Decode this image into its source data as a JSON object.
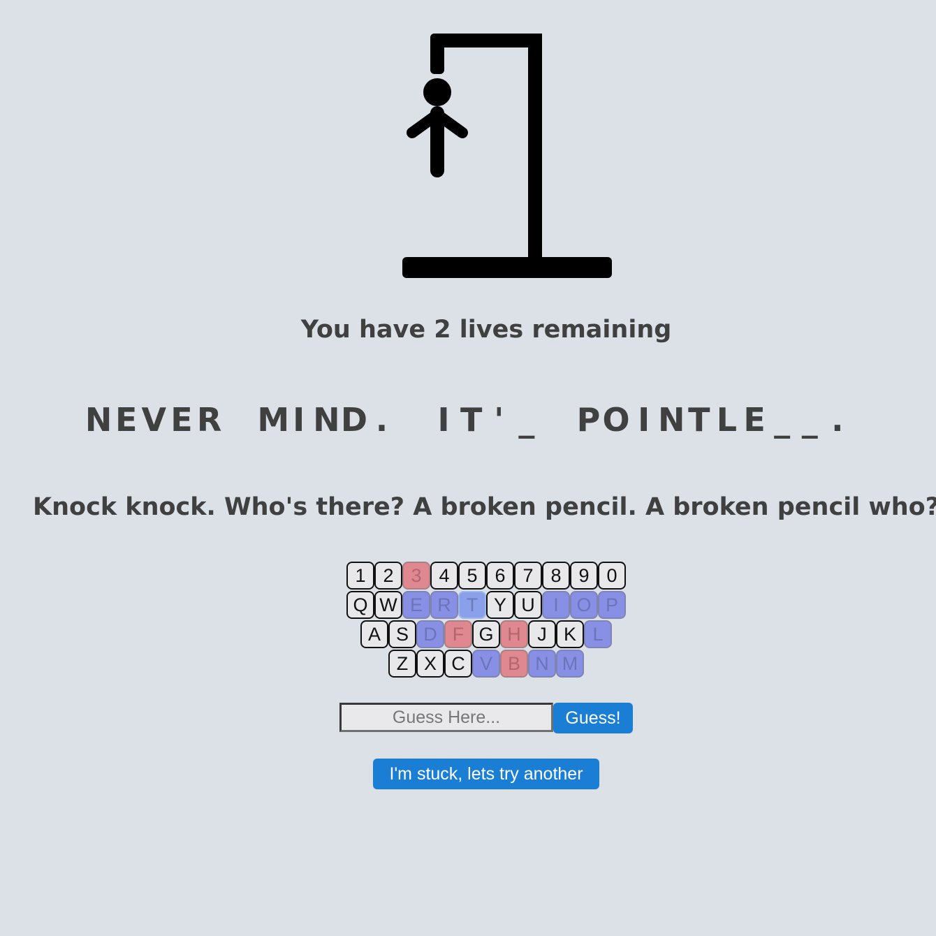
{
  "game": {
    "lives_text": "You have 2 lives remaining",
    "lives_remaining": 2,
    "puzzle_text": "NEVER MIND. IT'_ POINTLE__.",
    "hint": "Knock knock. Who's there? A broken pencil. A broken pencil who?"
  },
  "colors": {
    "correct": "#8890e6",
    "wrong": "#e08890",
    "button": "#1a7fd4",
    "background": "#dce0e7"
  },
  "keyboard": {
    "rows": [
      [
        {
          "label": "1",
          "state": "unused"
        },
        {
          "label": "2",
          "state": "unused"
        },
        {
          "label": "3",
          "state": "wrong"
        },
        {
          "label": "4",
          "state": "unused"
        },
        {
          "label": "5",
          "state": "unused"
        },
        {
          "label": "6",
          "state": "unused"
        },
        {
          "label": "7",
          "state": "unused"
        },
        {
          "label": "8",
          "state": "unused"
        },
        {
          "label": "9",
          "state": "unused"
        },
        {
          "label": "0",
          "state": "unused"
        }
      ],
      [
        {
          "label": "Q",
          "state": "unused"
        },
        {
          "label": "W",
          "state": "unused"
        },
        {
          "label": "E",
          "state": "correct"
        },
        {
          "label": "R",
          "state": "correct"
        },
        {
          "label": "T",
          "state": "focused"
        },
        {
          "label": "Y",
          "state": "unused"
        },
        {
          "label": "U",
          "state": "unused"
        },
        {
          "label": "I",
          "state": "correct"
        },
        {
          "label": "O",
          "state": "correct"
        },
        {
          "label": "P",
          "state": "correct"
        }
      ],
      [
        {
          "label": "A",
          "state": "unused"
        },
        {
          "label": "S",
          "state": "unused"
        },
        {
          "label": "D",
          "state": "correct"
        },
        {
          "label": "F",
          "state": "wrong"
        },
        {
          "label": "G",
          "state": "unused"
        },
        {
          "label": "H",
          "state": "wrong"
        },
        {
          "label": "J",
          "state": "unused"
        },
        {
          "label": "K",
          "state": "unused"
        },
        {
          "label": "L",
          "state": "correct"
        }
      ],
      [
        {
          "label": "Z",
          "state": "unused"
        },
        {
          "label": "X",
          "state": "unused"
        },
        {
          "label": "C",
          "state": "unused"
        },
        {
          "label": "V",
          "state": "correct"
        },
        {
          "label": "B",
          "state": "wrong"
        },
        {
          "label": "N",
          "state": "correct"
        },
        {
          "label": "M",
          "state": "correct"
        }
      ]
    ]
  },
  "guess": {
    "placeholder": "Guess Here...",
    "value": "",
    "button_label": "Guess!"
  },
  "skip_button_label": "I'm stuck, lets try another"
}
